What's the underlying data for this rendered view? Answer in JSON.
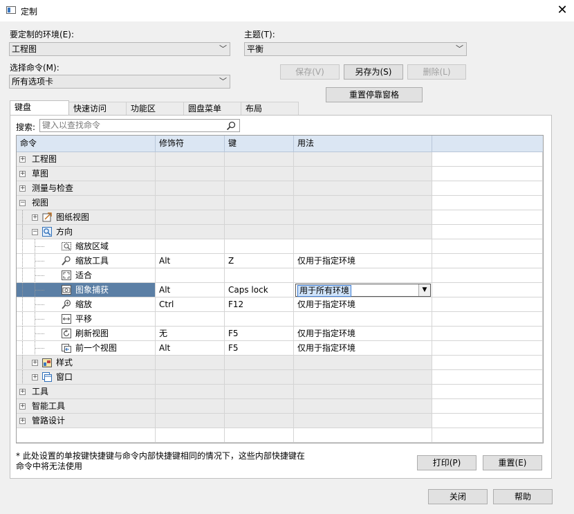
{
  "window": {
    "title": "定制",
    "close_glyph": "✕"
  },
  "environment": {
    "label": "要定制的环境(E):",
    "value": "工程图"
  },
  "theme": {
    "label": "主题(T):",
    "value": "平衡"
  },
  "command": {
    "label": "选择命令(M):",
    "value": "所有选项卡"
  },
  "buttons": {
    "save": "保存(V)",
    "save_as": "另存为(S)",
    "delete": "删除(L)",
    "reset_dock": "重置停靠窗格",
    "print": "打印(P)",
    "reset": "重置(E)",
    "close": "关闭",
    "help": "帮助"
  },
  "tabs": [
    "键盘",
    "快速访问",
    "功能区",
    "圆盘菜单",
    "布局"
  ],
  "search": {
    "label": "搜索:",
    "placeholder": "键入以查找命令"
  },
  "grid": {
    "headers": [
      "命令",
      "修饰符",
      "键",
      "用法"
    ],
    "rows": [
      {
        "level": 0,
        "expander": "+",
        "icon": "",
        "label": "工程图",
        "mod": "",
        "key": "",
        "usage": "",
        "grey": true
      },
      {
        "level": 0,
        "expander": "+",
        "icon": "",
        "label": "草图",
        "mod": "",
        "key": "",
        "usage": "",
        "grey": true
      },
      {
        "level": 0,
        "expander": "+",
        "icon": "",
        "label": "测量与检查",
        "mod": "",
        "key": "",
        "usage": "",
        "grey": true
      },
      {
        "level": 0,
        "expander": "−",
        "icon": "",
        "label": "视图",
        "mod": "",
        "key": "",
        "usage": "",
        "grey": true
      },
      {
        "level": 1,
        "expander": "+",
        "icon": "sheet-view-icon",
        "label": "图纸视图",
        "mod": "",
        "key": "",
        "usage": "",
        "grey": true
      },
      {
        "level": 1,
        "expander": "−",
        "icon": "orient-icon",
        "label": "方向",
        "mod": "",
        "key": "",
        "usage": "",
        "grey": true
      },
      {
        "level": 2,
        "expander": "",
        "icon": "zoom-area-icon",
        "label": "缩放区域",
        "mod": "",
        "key": "",
        "usage": "",
        "grey": false
      },
      {
        "level": 2,
        "expander": "",
        "icon": "zoom-tool-icon",
        "label": "缩放工具",
        "mod": "Alt",
        "key": "Z",
        "usage": "仅用于指定环境",
        "grey": false
      },
      {
        "level": 2,
        "expander": "",
        "icon": "fit-icon",
        "label": "适合",
        "mod": "",
        "key": "",
        "usage": "",
        "grey": false
      },
      {
        "level": 2,
        "expander": "",
        "icon": "camera-icon",
        "label": "图象捕获",
        "mod": "Alt",
        "key": "Caps lock",
        "usage": "用于所有环境",
        "grey": false,
        "selected": true
      },
      {
        "level": 2,
        "expander": "",
        "icon": "zoom-icon",
        "label": "缩放",
        "mod": "Ctrl",
        "key": "F12",
        "usage": "仅用于指定环境",
        "grey": false
      },
      {
        "level": 2,
        "expander": "",
        "icon": "pan-icon",
        "label": "平移",
        "mod": "",
        "key": "",
        "usage": "",
        "grey": false
      },
      {
        "level": 2,
        "expander": "",
        "icon": "refresh-icon",
        "label": "刷新视图",
        "mod": "无",
        "key": "F5",
        "usage": "仅用于指定环境",
        "grey": false
      },
      {
        "level": 2,
        "expander": "",
        "icon": "prev-view-icon",
        "label": "前一个视图",
        "mod": "Alt",
        "key": "F5",
        "usage": "仅用于指定环境",
        "grey": false
      },
      {
        "level": 1,
        "expander": "+",
        "icon": "style-icon",
        "label": "样式",
        "mod": "",
        "key": "",
        "usage": "",
        "grey": true
      },
      {
        "level": 1,
        "expander": "+",
        "icon": "window-icon",
        "label": "窗口",
        "mod": "",
        "key": "",
        "usage": "",
        "grey": true
      },
      {
        "level": 0,
        "expander": "+",
        "icon": "",
        "label": "工具",
        "mod": "",
        "key": "",
        "usage": "",
        "grey": true
      },
      {
        "level": 0,
        "expander": "+",
        "icon": "",
        "label": "智能工具",
        "mod": "",
        "key": "",
        "usage": "",
        "grey": true
      },
      {
        "level": 0,
        "expander": "+",
        "icon": "",
        "label": "管路设计",
        "mod": "",
        "key": "",
        "usage": "",
        "grey": true
      }
    ]
  },
  "note": "* 此处设置的单按键快捷键与命令内部快捷键相同的情况下，这些内部快捷键在命令中将无法使用",
  "colors": {
    "selected_row": "#5b7fa5",
    "header_bg": "#dbe6f3"
  }
}
